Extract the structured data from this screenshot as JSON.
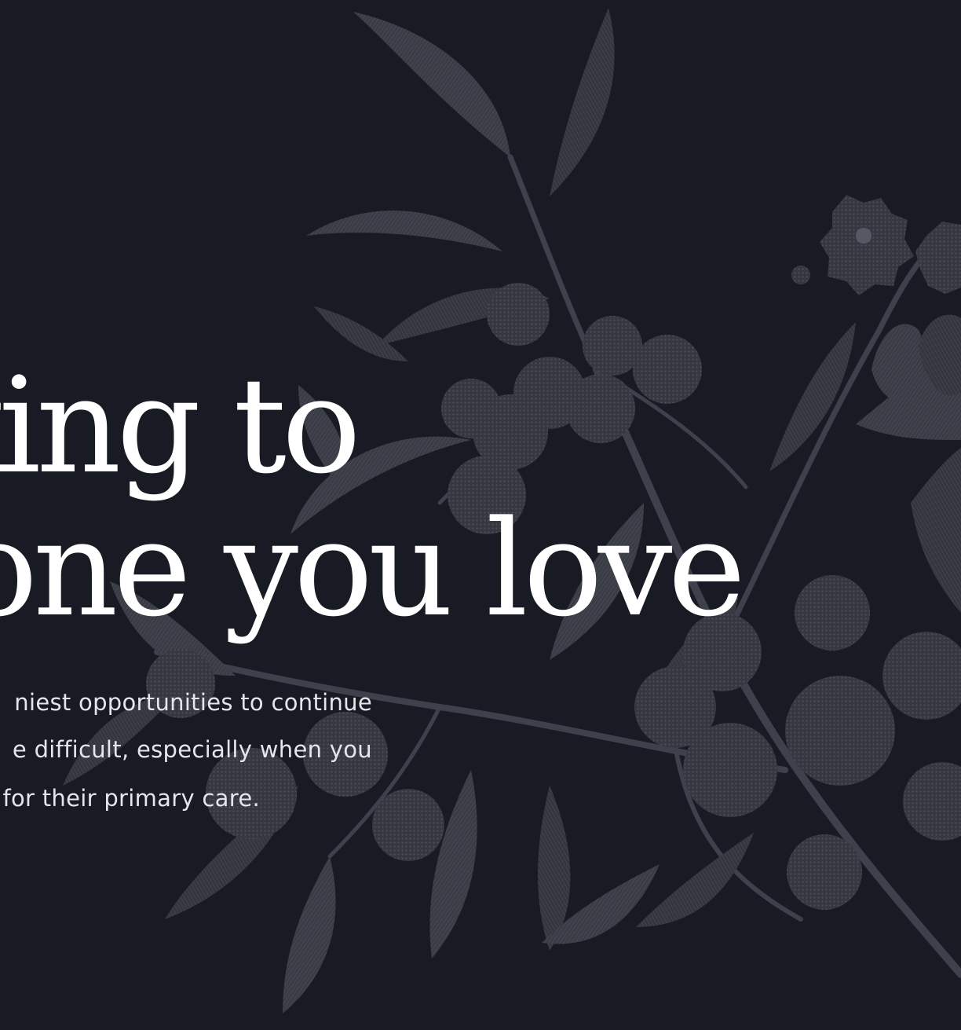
{
  "colors": {
    "background": "#181b24",
    "foliage": "#3b3d47",
    "foliage_light": "#4a4c57",
    "headline_text": "#ffffff",
    "body_text": "#e4e6ea"
  },
  "hero": {
    "headline_lines": [
      "king to",
      "neone you love"
    ],
    "body_lines": [
      "niest opportunities to continue",
      "e difficult, especially when you",
      "for their primary care."
    ]
  }
}
